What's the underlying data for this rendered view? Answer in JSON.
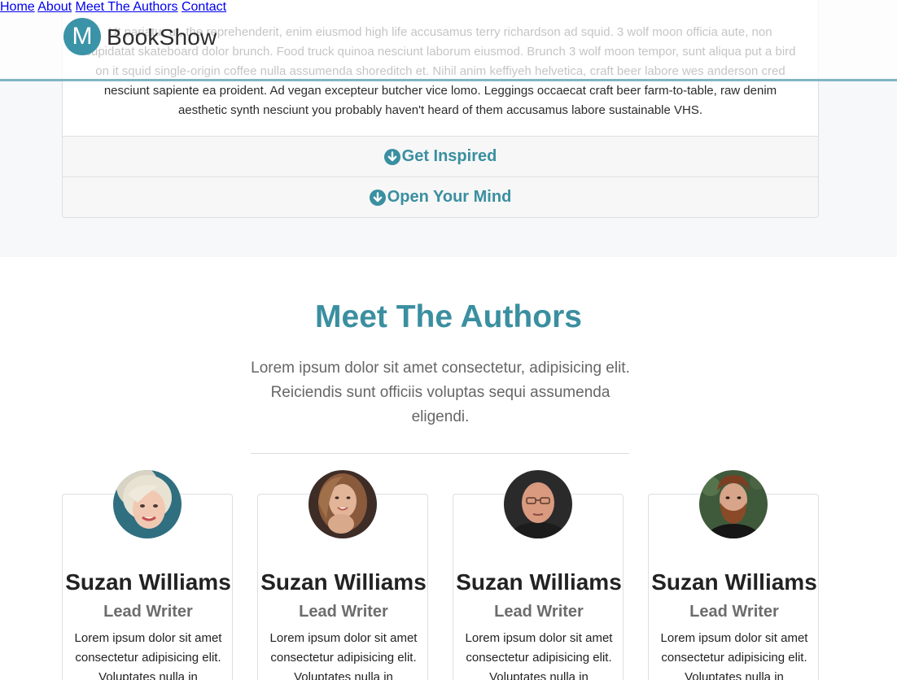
{
  "accordion": {
    "body_text": "Ut pariatur ut, the reprehenderit, enim eiusmod high life accusamus terry richardson ad squid. 3 wolf moon officia aute, non cupidatat skateboard dolor brunch. Food truck quinoa nesciunt laborum eiusmod. Brunch 3 wolf moon tempor, sunt aliqua put a bird on it squid single-origin coffee nulla assumenda shoreditch et. Nihil anim keffiyeh helvetica, craft beer labore wes anderson cred nesciunt sapiente ea proident. Ad vegan excepteur butcher vice lomo. Leggings occaecat craft beer farm-to-table, raw denim aesthetic synth nesciunt you probably haven't heard of them accusamus labore sustainable VHS.",
    "items": [
      {
        "label": "Get Inspired"
      },
      {
        "label": "Open Your Mind"
      }
    ]
  },
  "navbar": {
    "logo_letter": "M",
    "brand": "BookShow",
    "links": [
      {
        "label": "Home"
      },
      {
        "label": "About"
      },
      {
        "label": "Meet The Authors"
      },
      {
        "label": "Contact"
      }
    ]
  },
  "authors_section": {
    "title": "Meet The Authors",
    "lead": "Lorem ipsum dolor sit amet consectetur, adipisicing elit. Reiciendis sunt officiis voluptas sequi assumenda eligendi.",
    "cards": [
      {
        "name": "Suzan Williams",
        "role": "Lead Writer",
        "text": "Lorem ipsum dolor sit amet consectetur adipisicing elit. Voluptates nulla in",
        "avatar": "blonde-woman-photo"
      },
      {
        "name": "Suzan Williams",
        "role": "Lead Writer",
        "text": "Lorem ipsum dolor sit amet consectetur adipisicing elit. Voluptates nulla in",
        "avatar": "brunette-woman-photo"
      },
      {
        "name": "Suzan Williams",
        "role": "Lead Writer",
        "text": "Lorem ipsum dolor sit amet consectetur adipisicing elit. Voluptates nulla in",
        "avatar": "older-man-glasses-photo"
      },
      {
        "name": "Suzan Williams",
        "role": "Lead Writer",
        "text": "Lorem ipsum dolor sit amet consectetur adipisicing elit. Voluptates nulla in",
        "avatar": "bearded-man-photo"
      }
    ]
  },
  "colors": {
    "accent": "#3a8fa0",
    "logo": "#3b93a8",
    "nav_border": "#7fb6c2",
    "band_bg": "#f6f8fa"
  }
}
